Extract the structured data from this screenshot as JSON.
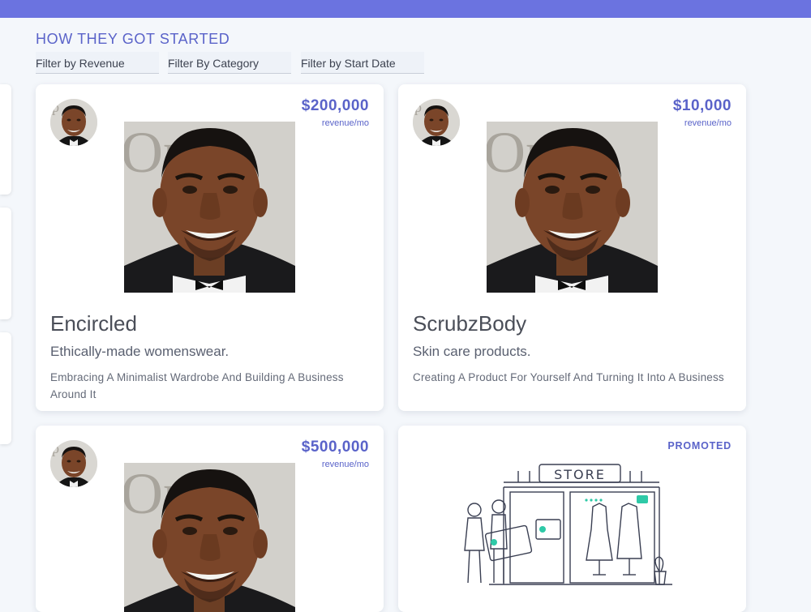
{
  "header": {
    "title": "HOW THEY GOT STARTED"
  },
  "filters": [
    {
      "label": "Filter by Revenue"
    },
    {
      "label": "Filter By Category"
    },
    {
      "label": "Filter by Start Date"
    }
  ],
  "cards": [
    {
      "revenue": "$200,000",
      "revenue_unit": "revenue/mo",
      "title": "Encircled",
      "subtitle": "Ethically-made womenswear.",
      "description": "Embracing A Minimalist Wardrobe And Building A Business Around It"
    },
    {
      "revenue": "$10,000",
      "revenue_unit": "revenue/mo",
      "title": "ScrubzBody",
      "subtitle": "Skin care products.",
      "description": "Creating A Product For Yourself And Turning It Into A Business"
    },
    {
      "revenue": "$500,000",
      "revenue_unit": "revenue/mo"
    }
  ],
  "promo": {
    "badge": "PROMOTED",
    "store_sign": "STORE"
  },
  "colors": {
    "accent": "#5a63c9",
    "topbar": "#6b73e0",
    "teal": "#2ec9a7"
  }
}
